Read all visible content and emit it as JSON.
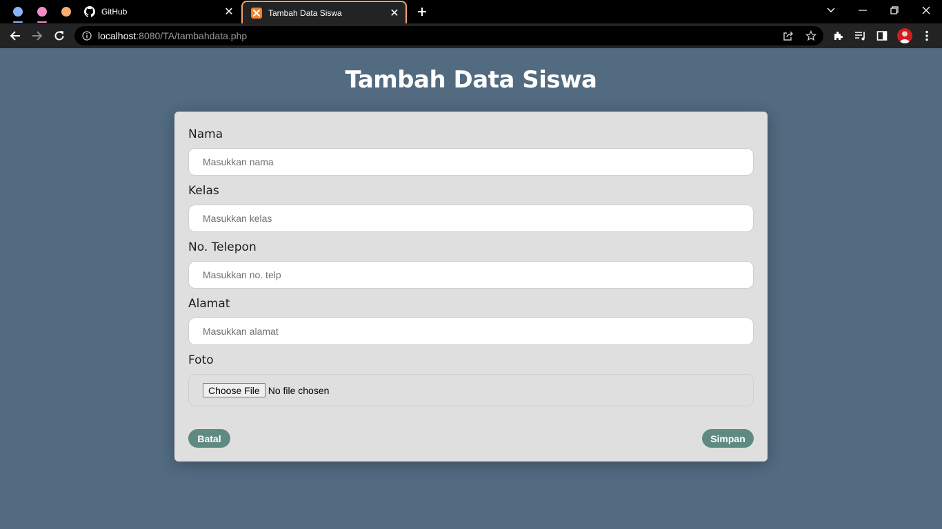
{
  "browser": {
    "tabs": [
      {
        "title": "GitHub",
        "active": false
      },
      {
        "title": "Tambah Data Siswa",
        "active": true
      }
    ],
    "address": {
      "host": "localhost",
      "path": ":8080/TA/tambahdata.php"
    },
    "colors": {
      "dot_blue": "#8ab4f8",
      "dot_pink": "#f28bc8",
      "dot_orange": "#fcad70",
      "active_tab_border": "#f2a36e"
    }
  },
  "page": {
    "title": "Tambah Data Siswa",
    "background": "#526b80",
    "accent": "#5f8a82"
  },
  "form": {
    "fields": [
      {
        "label": "Nama",
        "placeholder": "Masukkan nama"
      },
      {
        "label": "Kelas",
        "placeholder": "Masukkan kelas"
      },
      {
        "label": "No. Telepon",
        "placeholder": "Masukkan no. telp"
      },
      {
        "label": "Alamat",
        "placeholder": "Masukkan alamat"
      }
    ],
    "foto": {
      "label": "Foto",
      "button": "Choose File",
      "status": "No file chosen"
    },
    "cancel_label": "Batal",
    "submit_label": "Simpan"
  }
}
